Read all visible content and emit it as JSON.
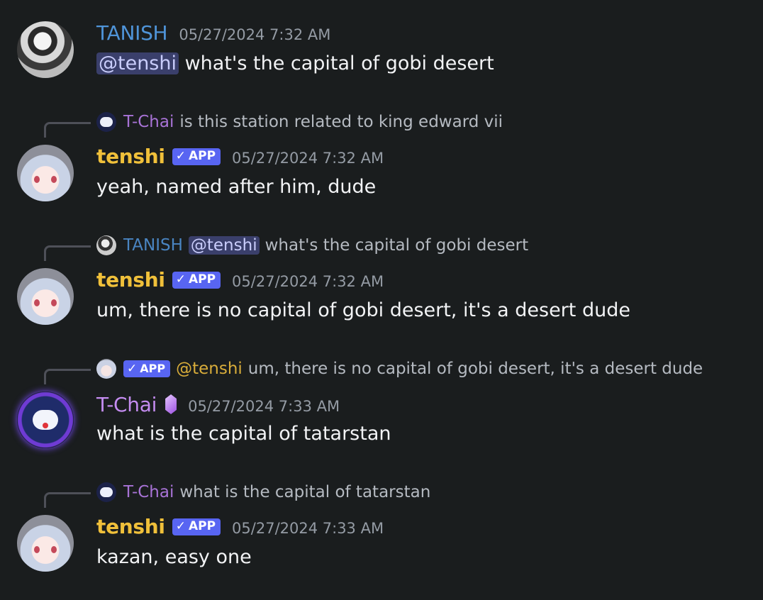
{
  "messages": [
    {
      "author": "TANISH",
      "timestamp": "05/27/2024 7:32 AM",
      "mention": "@tenshi",
      "text": "what's the capital of gobi desert"
    },
    {
      "reply": {
        "author": "T-Chai",
        "text": "is this station related to king edward vii"
      },
      "author": "tenshi",
      "badge": "APP",
      "timestamp": "05/27/2024 7:32 AM",
      "text": "yeah, named after him, dude"
    },
    {
      "reply": {
        "author": "TANISH",
        "mention": "@tenshi",
        "text": "what's the capital of gobi desert"
      },
      "author": "tenshi",
      "badge": "APP",
      "timestamp": "05/27/2024 7:32 AM",
      "text": "um, there is no capital of gobi desert, it's a desert dude"
    },
    {
      "reply": {
        "badge": "APP",
        "author": "@tenshi",
        "text": "um, there is no capital of gobi desert, it's a desert dude"
      },
      "author": "T-Chai",
      "timestamp": "05/27/2024 7:33 AM",
      "text": "what is the capital of tatarstan"
    },
    {
      "reply": {
        "author": "T-Chai",
        "text": "what is the capital of tatarstan"
      },
      "author": "tenshi",
      "badge": "APP",
      "timestamp": "05/27/2024 7:33 AM",
      "text": "kazan, easy one"
    }
  ],
  "badge_check": "✓",
  "colors": {
    "background": "#1a1d1e",
    "tanish": "#4f94d8",
    "tenshi": "#f0c03a",
    "tchai": "#c48cf0",
    "app_badge": "#5865f2",
    "mention_bg": "#3a3f6b"
  }
}
